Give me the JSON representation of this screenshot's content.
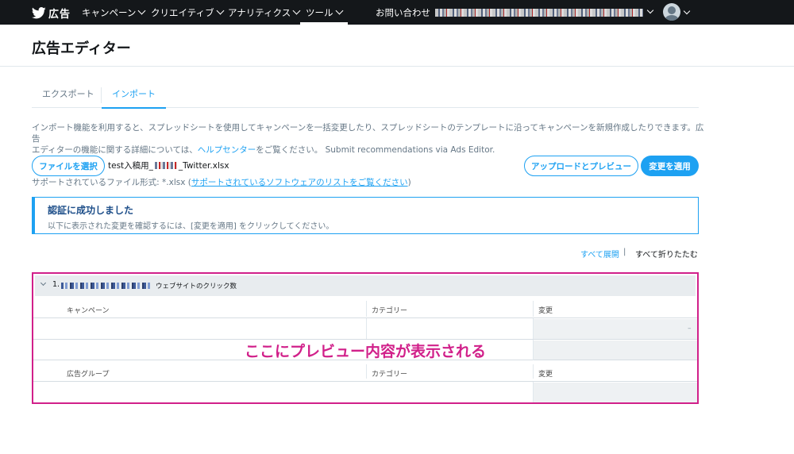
{
  "nav": {
    "brand": "広告",
    "items": [
      "キャンペーン",
      "クリエイティブ",
      "アナリティクス",
      "ツール"
    ],
    "contact": "お問い合わせ"
  },
  "page": {
    "title": "広告エディター"
  },
  "tabs": [
    "エクスポート",
    "インポート"
  ],
  "description": {
    "line1": "インポート機能を利用すると、スプレッドシートを使用してキャンペーンを一括変更したり、スプレッドシートのテンプレートに沿ってキャンペーンを新規作成したりできます。広告",
    "line2_before": "エディターの機能に関する詳細については、",
    "help_link": "ヘルプセンター",
    "line2_after": "をご覧ください。 Submit recommendations via Ads Editor."
  },
  "file": {
    "choose_button": "ファイルを選択",
    "name_prefix": "test入稿用_",
    "name_suffix": "_Twitter.xlsx",
    "support_prefix": "サポートされているファイル形式: *.xlsx (",
    "support_link": "サポートされているソフトウェアのリストをご覧ください",
    "support_suffix": ")"
  },
  "actions": {
    "upload_preview": "アップロードとプレビュー",
    "apply": "変更を適用"
  },
  "alert": {
    "title": "認証に成功しました",
    "text": "以下に表示された変更を確認するには、[変更を適用] をクリックしてください。"
  },
  "expand": {
    "expand_all": "すべて展開",
    "separator": "|",
    "collapse_all": "すべて折りたたむ"
  },
  "preview": {
    "group_number": "1.",
    "group_objective": "ウェブサイトのクリック数",
    "campaign_table": {
      "headers": [
        "キャンペーン",
        "カテゴリー",
        "変更"
      ],
      "dash": "–"
    },
    "adgroup_table": {
      "headers": [
        "広告グループ",
        "カテゴリー",
        "変更"
      ]
    },
    "placeholder_message": "ここにプレビュー内容が表示される"
  },
  "colors": {
    "accent": "#1da1f2",
    "highlight": "#d1208a",
    "nav_bg": "#14171a"
  }
}
